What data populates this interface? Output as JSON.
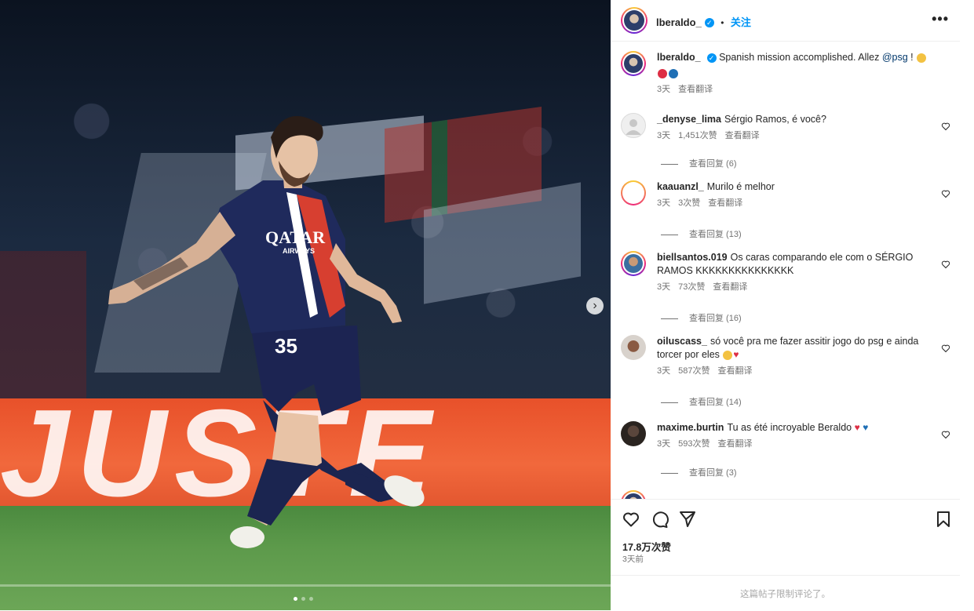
{
  "header": {
    "username": "lberaldo_",
    "separator": "•",
    "follow_label": "关注",
    "more_label": "•••"
  },
  "caption": {
    "username": "lberaldo_",
    "text": "Spanish mission accomplished. Allez ",
    "mention": "@psg",
    "text_after": " ! ",
    "time": "3天",
    "translate": "查看翻译"
  },
  "comments": [
    {
      "username": "_denyse_lima",
      "text": "Sérgio Ramos, é você?",
      "time": "3天",
      "likes": "1,451次赞",
      "translate": "查看翻译",
      "replies": "查看回复 (6)"
    },
    {
      "username": "kaauanzl_",
      "text": "Murilo é melhor",
      "time": "3天",
      "likes": "3次赞",
      "translate": "查看翻译",
      "replies": "查看回复 (13)"
    },
    {
      "username": "biellsantos.019",
      "text": "Os caras comparando ele com o SÉRGIO RAMOS KKKKKKKKKKKKKKK",
      "time": "3天",
      "likes": "73次赞",
      "translate": "查看翻译",
      "replies": "查看回复 (16)"
    },
    {
      "username": "oiluscass_",
      "text": "só você pra me fazer assitir jogo do psg e ainda torcer por eles ",
      "time": "3天",
      "likes": "587次赞",
      "translate": "查看翻译",
      "replies": "查看回复 (14)"
    },
    {
      "username": "maxime.burtin",
      "text": "Tu as été incroyable Beraldo ",
      "time": "3天",
      "likes": "593次赞",
      "translate": "查看翻译",
      "replies": "查看回复 (3)"
    }
  ],
  "actions": {
    "likes_count": "17.8万次赞",
    "posted_time": "3天前"
  },
  "footer": {
    "comments_limited": "这篇帖子限制评论了。"
  },
  "media": {
    "board_text": "JUSTE",
    "jersey_sponsor_line1": "QATAR",
    "jersey_sponsor_line2": "AIRWAYS",
    "shorts_number": "35",
    "next_icon": "›",
    "carousel_pages": 3,
    "carousel_active": 1
  },
  "colors": {
    "accent": "#0095f6",
    "text_primary": "#262626",
    "text_secondary": "#737373",
    "divider": "#efefef",
    "mention": "#00376b"
  }
}
